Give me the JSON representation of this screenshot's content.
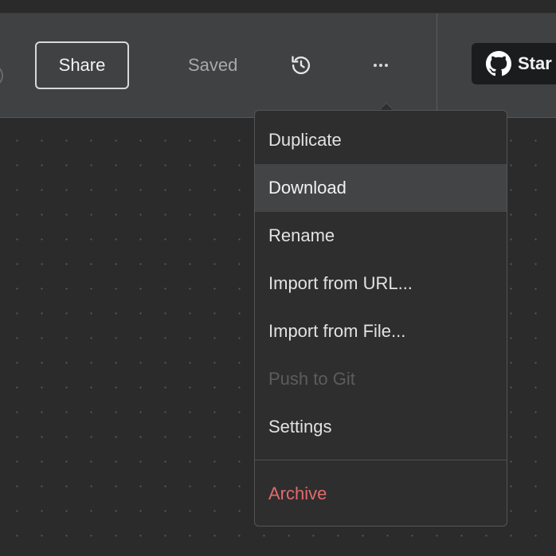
{
  "toolbar": {
    "share_label": "Share",
    "status_label": "Saved",
    "star_label": "Star"
  },
  "menu": {
    "items": [
      {
        "label": "Duplicate",
        "state": "normal"
      },
      {
        "label": "Download",
        "state": "hover"
      },
      {
        "label": "Rename",
        "state": "normal"
      },
      {
        "label": "Import from URL...",
        "state": "normal"
      },
      {
        "label": "Import from File...",
        "state": "normal"
      },
      {
        "label": "Push to Git",
        "state": "disabled"
      },
      {
        "label": "Settings",
        "state": "normal"
      }
    ],
    "danger_item": {
      "label": "Archive",
      "state": "danger"
    }
  },
  "icons": {
    "history": "history-icon",
    "more": "more-horizontal-icon",
    "github": "github-icon"
  },
  "colors": {
    "toolbar_bg": "#404142",
    "canvas_bg": "#2b2b2b",
    "menu_bg": "#2e2e2f",
    "menu_hover": "#434446",
    "danger": "#e26a6a",
    "star_button_bg": "#1b1c1e"
  }
}
